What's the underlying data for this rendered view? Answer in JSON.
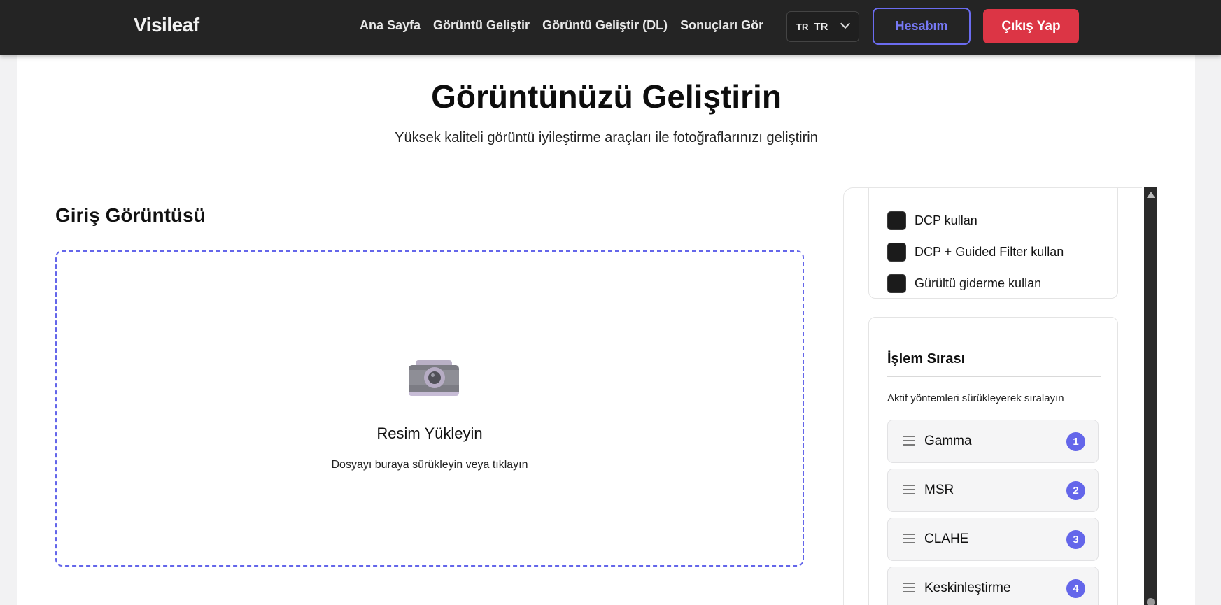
{
  "brand": {
    "logo_text": "Visileaf"
  },
  "nav": {
    "links": [
      {
        "label": "Ana Sayfa"
      },
      {
        "label": "Görüntü Geliştir"
      },
      {
        "label": "Görüntü Geliştir (DL)"
      },
      {
        "label": "Sonuçları Gör"
      }
    ],
    "language": {
      "flag": "TR",
      "value": "TR"
    },
    "account_label": "Hesabım",
    "logout_label": "Çıkış Yap"
  },
  "hero": {
    "title": "Görüntünüzü Geliştirin",
    "subtitle": "Yüksek kaliteli görüntü iyileştirme araçları ile fotoğraflarınızı geliştirin"
  },
  "input": {
    "section_title": "Giriş Görüntüsü",
    "dropzone_icon": "camera-icon",
    "dropzone_title": "Resim Yükleyin",
    "dropzone_subtitle": "Dosyayı buraya sürükleyin veya tıklayın"
  },
  "options": {
    "checkboxes": [
      {
        "label": "DCP kullan",
        "checked": false
      },
      {
        "label": "DCP + Guided Filter kullan",
        "checked": false
      },
      {
        "label": "Gürültü giderme kullan",
        "checked": false
      }
    ]
  },
  "order": {
    "title": "İşlem Sırası",
    "hint": "Aktif yöntemleri sürükleyerek sıralayın",
    "items": [
      {
        "label": "Gamma",
        "index": "1"
      },
      {
        "label": "MSR",
        "index": "2"
      },
      {
        "label": "CLAHE",
        "index": "3"
      },
      {
        "label": "Keskinleştirme",
        "index": "4"
      }
    ]
  },
  "colors": {
    "navbar_bg": "#242424",
    "accent": "#6466ea",
    "danger": "#dc3545"
  }
}
